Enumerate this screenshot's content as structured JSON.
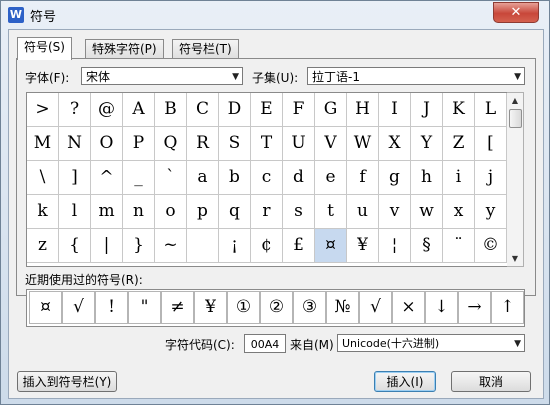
{
  "window": {
    "title": "符号",
    "close_symbol": "✕"
  },
  "tabs": [
    {
      "label": "符号(S)",
      "active": true
    },
    {
      "label": "特殊字符(P)",
      "active": false
    },
    {
      "label": "符号栏(T)",
      "active": false
    }
  ],
  "font": {
    "label": "字体(F):",
    "value": "宋体"
  },
  "subset": {
    "label": "子集(U):",
    "value": "拉丁语-1"
  },
  "symbol_grid": {
    "rows": [
      [
        ">",
        "?",
        "@",
        "A",
        "B",
        "C",
        "D",
        "E",
        "F",
        "G",
        "H",
        "I",
        "J",
        "K",
        "L"
      ],
      [
        "M",
        "N",
        "O",
        "P",
        "Q",
        "R",
        "S",
        "T",
        "U",
        "V",
        "W",
        "X",
        "Y",
        "Z",
        "["
      ],
      [
        "\\",
        "]",
        "^",
        "_",
        "`",
        "a",
        "b",
        "c",
        "d",
        "e",
        "f",
        "g",
        "h",
        "i",
        "j"
      ],
      [
        "k",
        "l",
        "m",
        "n",
        "o",
        "p",
        "q",
        "r",
        "s",
        "t",
        "u",
        "v",
        "w",
        "x",
        "y"
      ],
      [
        "z",
        "{",
        "|",
        "}",
        "~",
        "",
        "¡",
        "¢",
        "£",
        "¤",
        "¥",
        "¦",
        "§",
        "¨",
        "©"
      ]
    ],
    "selected": "¤"
  },
  "recent": {
    "label": "近期使用过的符号(R):",
    "symbols": [
      "¤",
      "√",
      "!",
      "\"",
      "≠",
      "¥",
      "①",
      "②",
      "③",
      "№",
      "√",
      "×",
      "↓",
      "→",
      "↑"
    ]
  },
  "char_code": {
    "label": "字符代码(C):",
    "value": "00A4"
  },
  "from": {
    "label": "来自(M)",
    "value": "Unicode(十六进制)"
  },
  "buttons": {
    "insert_to_bar": "插入到符号栏(Y)",
    "insert": "插入(I)",
    "cancel": "取消"
  }
}
